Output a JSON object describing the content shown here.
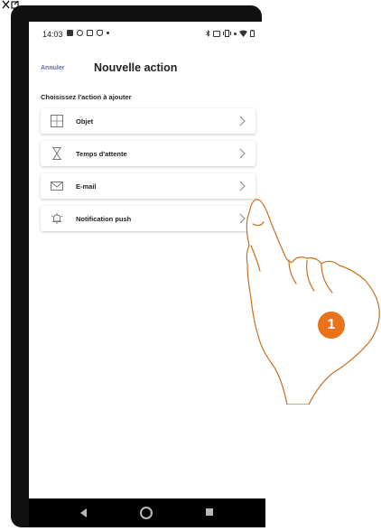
{
  "status_bar": {
    "time": "14:03"
  },
  "header": {
    "cancel_label": "Annuler",
    "title": "Nouvelle action"
  },
  "section": {
    "subtitle": "Choisissez l'action à ajouter"
  },
  "actions": [
    {
      "label": "Objet",
      "icon": "grid-icon"
    },
    {
      "label": "Temps d'attente",
      "icon": "hourglass-icon"
    },
    {
      "label": "E-mail",
      "icon": "envelope-icon"
    },
    {
      "label": "Notification push",
      "icon": "bell-icon"
    }
  ],
  "annotation": {
    "step": "1"
  },
  "colors": {
    "accent": "#5b6fb5",
    "callout": "#e8731a",
    "hand_stroke": "#c8701e"
  }
}
